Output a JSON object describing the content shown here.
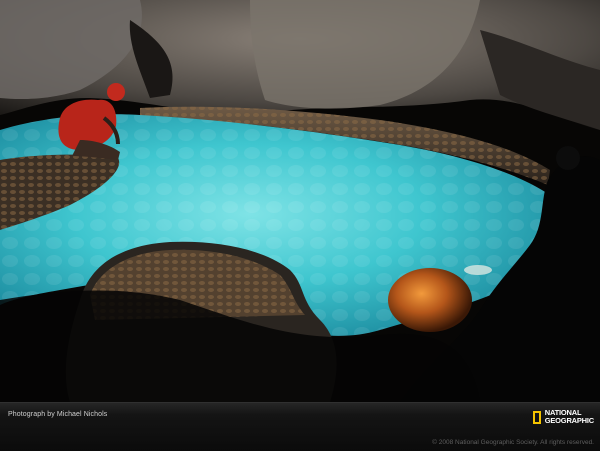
{
  "image": {
    "subject": "cave-pool-photo",
    "colors": {
      "pool": "#37c6cf",
      "pool_deep": "#1a9bb0",
      "rock": "#5a5550",
      "shadow": "#050505",
      "lamp_glow": "#d4731f",
      "caver_suit": "#c5261c"
    }
  },
  "caption": {
    "photo_credit": "Photograph by Michael Nichols",
    "copyright": "© 2008 National Geographic Society. All rights reserved."
  },
  "logo": {
    "line1": "NATIONAL",
    "line2": "GEOGRAPHIC",
    "frame_color": "#f5c400"
  }
}
